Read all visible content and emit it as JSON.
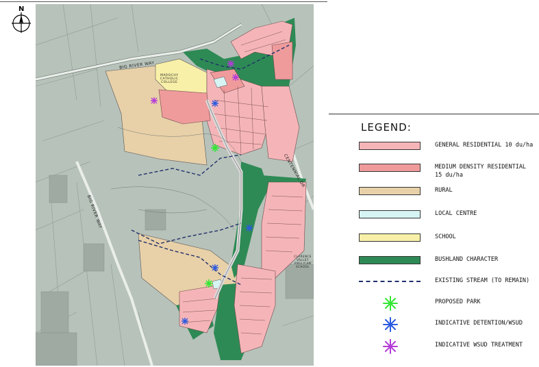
{
  "north_arrow": {
    "label": "N",
    "icon": "north-arrow-icon"
  },
  "map": {
    "road_labels": {
      "big_river_way_top": "BIG RIVER WAY",
      "big_river_way_side": "BIG RIVER WAY",
      "cent_road": "CENTENNIAL DR"
    },
    "places": {
      "college": "MAROCHY\nCATHOLIC\nCOLLEGE",
      "school": "CLARENCE\nVALLEY ANGLICAN\nSCHOOL"
    }
  },
  "legend": {
    "title": "LEGEND:",
    "items": [
      {
        "label": "GENERAL RESIDENTIAL 10 du/ha",
        "type": "swatch",
        "color": "#f5b5b8"
      },
      {
        "label": "MEDIUM DENSITY RESIDENTIAL\n15 du/ha",
        "type": "swatch",
        "color": "#ef9b9c"
      },
      {
        "label": "RURAL",
        "type": "swatch",
        "color": "#e8d0a8"
      },
      {
        "label": "LOCAL CENTRE",
        "type": "swatch",
        "color": "#d7f4f4"
      },
      {
        "label": "SCHOOL",
        "type": "swatch",
        "color": "#f8f0a8"
      },
      {
        "label": "BUSHLAND CHARACTER",
        "type": "swatch",
        "color": "#2e8a55"
      },
      {
        "label": "EXISTING STREAM (TO REMAIN)",
        "type": "line",
        "color": "#1f2f6a"
      },
      {
        "label": "PROPOSED PARK",
        "type": "star",
        "color": "#33e633",
        "icon": "green-star-icon"
      },
      {
        "label": "INDICATIVE DETENTION/WSUD",
        "type": "star",
        "color": "#2a5ae0",
        "icon": "blue-star-icon"
      },
      {
        "label": "INDICATIVE WSUD TREATMENT",
        "type": "star",
        "color": "#b43ad8",
        "icon": "purple-star-icon"
      }
    ]
  }
}
